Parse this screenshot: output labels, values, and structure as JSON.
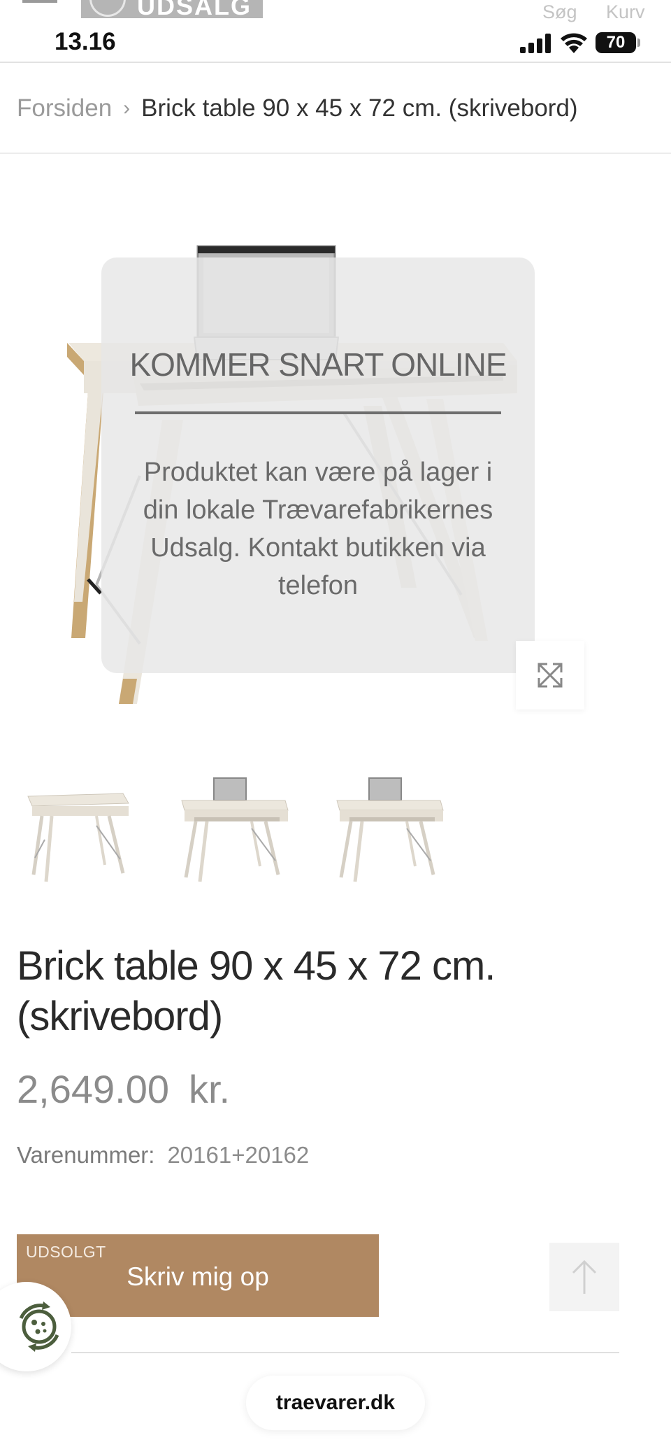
{
  "header": {
    "logo_text": "UDSALG",
    "search_label": "Søg",
    "cart_label": "Kurv"
  },
  "status_bar": {
    "time": "13.16",
    "battery": "70"
  },
  "breadcrumb": {
    "home": "Forsiden",
    "separator": "›",
    "current": "Brick table 90 x 45 x 72 cm. (skrivebord)"
  },
  "overlay": {
    "title": "KOMMER SNART ONLINE",
    "text": "Produktet kan være på lager i din lokale Trævarefabrikernes Udsalg. Kontakt butikken via telefon"
  },
  "product": {
    "title": "Brick table 90 x 45 x 72 cm. (skrivebord)",
    "price": "2,649.00",
    "currency": "kr.",
    "sku_label": "Varenummer:",
    "sku_value": "20161+20162"
  },
  "cart": {
    "status": "UDSOLGT",
    "button_label": "Skriv mig op"
  },
  "browser": {
    "url": "traevarer.dk"
  },
  "colors": {
    "accent_button": "#b08862",
    "wood": "#c9a874",
    "table_white": "#e9e4da"
  },
  "icons": {
    "zoom": "expand-icon",
    "scroll_top": "arrow-up-icon",
    "cookie": "cookie-icon"
  }
}
